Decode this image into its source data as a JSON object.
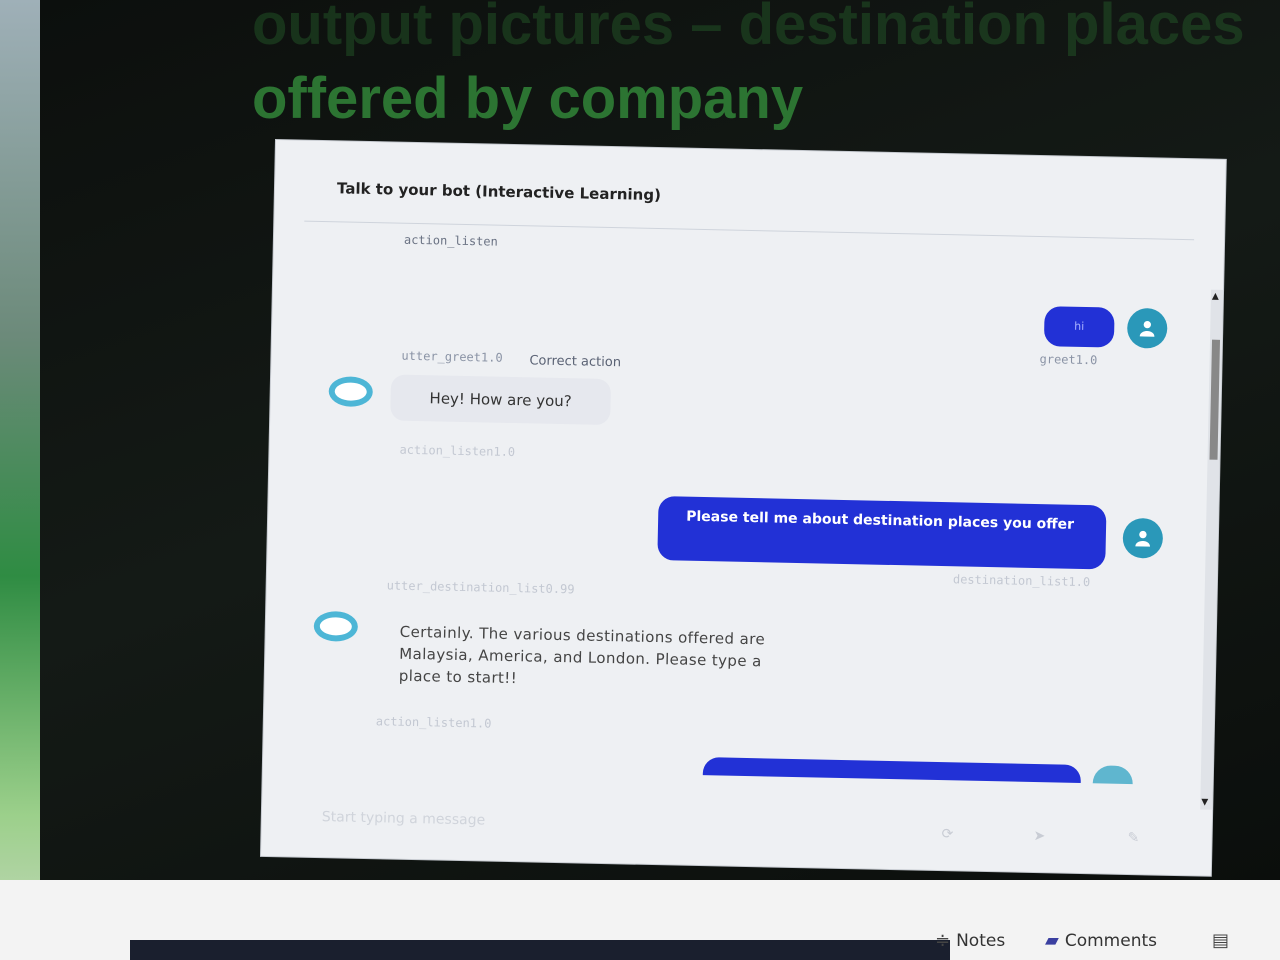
{
  "slide": {
    "title_line1": "output pictures – destination places",
    "title_line2": "offered by company"
  },
  "panel": {
    "title": "Talk to your bot (Interactive Learning)",
    "messages": {
      "label_action_listen_top": "action_listen",
      "user_hi": "hi",
      "label_greet": "greet1.0",
      "label_utter_greet": "utter_greet1.0",
      "correct_action": "Correct action",
      "bot_greet": "Hey! How are you?",
      "label_action_listen_2": "action_listen1.0",
      "user_destination": "Please tell me about destination places you offer",
      "label_destination_list": "destination_list1.0",
      "label_utter_destination": "utter_destination_list0.99",
      "bot_destination": "Certainly. The various destinations offered are Malaysia, America, and London. Please type a place to start!!",
      "label_action_listen_3": "action_listen1.0"
    },
    "input": {
      "placeholder": "Start typing a message"
    }
  },
  "taskbar": {
    "notes_label": "Notes",
    "comments_label": "Comments"
  },
  "colors": {
    "user_bubble": "#2231d6",
    "avatar": "#2a98b9",
    "bot_avatar_ring": "#4db6d6",
    "slide_title": "#2e7a34"
  }
}
